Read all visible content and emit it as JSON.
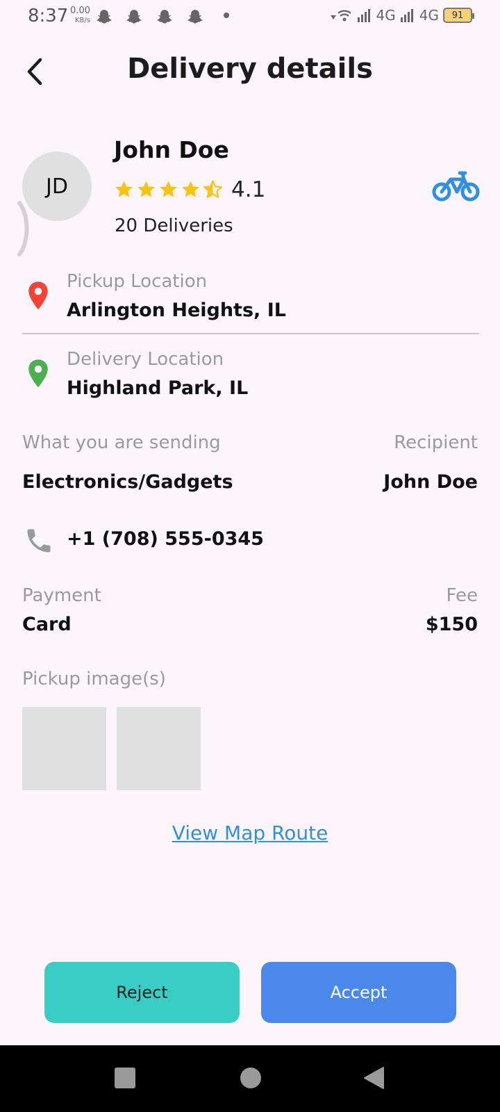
{
  "status_bar": {
    "time": "8:37",
    "speed_value": "0.00",
    "speed_unit": "KB/s",
    "network_left": "4G",
    "network_right": "4G",
    "battery": "91"
  },
  "header": {
    "title": "Delivery details",
    "back_icon": "chevron-left-icon"
  },
  "courier": {
    "initials": "JD",
    "name": "John Doe",
    "rating": "4.1",
    "stars_filled_fraction": 0.82,
    "deliveries": "20 Deliveries",
    "vehicle_icon": "bicycle-icon"
  },
  "pickup": {
    "label": "Pickup Location",
    "value": "Arlington Heights, IL"
  },
  "delivery": {
    "label": "Delivery Location",
    "value": "Highland Park, IL"
  },
  "package": {
    "sending_label": "What you are sending",
    "sending_value": "Electronics/Gadgets",
    "recipient_label": "Recipient",
    "recipient_value": "John Doe"
  },
  "phone": {
    "value": "+1 (708) 555-0345"
  },
  "payment": {
    "label": "Payment",
    "value": "Card",
    "fee_label": "Fee",
    "fee_value": "$150"
  },
  "pickup_images": {
    "label": "Pickup image(s)"
  },
  "map_link": "View Map Route",
  "actions": {
    "reject": "Reject",
    "accept": "Accept"
  },
  "colors": {
    "accent_blue": "#4a88ea",
    "reject_teal": "#39cdc6",
    "star": "#f9c216",
    "pin_red": "#f44336",
    "pin_green": "#4caf50",
    "link_blue": "#2f8fe0"
  }
}
